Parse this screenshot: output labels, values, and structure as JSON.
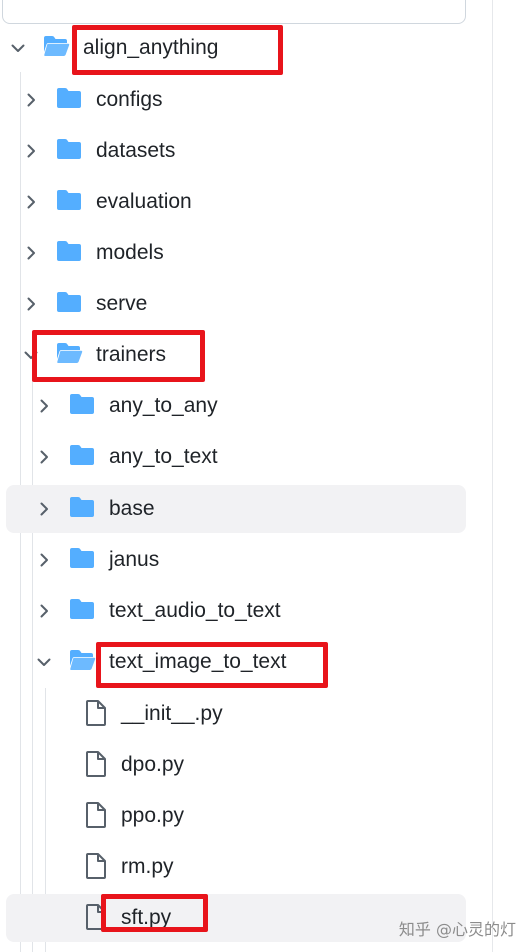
{
  "tree": {
    "root": {
      "label": "align_anything",
      "icon": "folder-open-icon"
    },
    "children": [
      {
        "label": "configs",
        "icon": "folder-icon"
      },
      {
        "label": "datasets",
        "icon": "folder-icon"
      },
      {
        "label": "evaluation",
        "icon": "folder-icon"
      },
      {
        "label": "models",
        "icon": "folder-icon"
      },
      {
        "label": "serve",
        "icon": "folder-icon"
      }
    ],
    "trainers": {
      "label": "trainers",
      "icon": "folder-open-icon"
    },
    "trainers_children": [
      {
        "label": "any_to_any",
        "icon": "folder-icon"
      },
      {
        "label": "any_to_text",
        "icon": "folder-icon"
      },
      {
        "label": "base",
        "icon": "folder-icon"
      },
      {
        "label": "janus",
        "icon": "folder-icon"
      },
      {
        "label": "text_audio_to_text",
        "icon": "folder-icon"
      }
    ],
    "tit": {
      "label": "text_image_to_text",
      "icon": "folder-open-icon"
    },
    "files": [
      {
        "label": "__init__.py",
        "icon": "file-icon"
      },
      {
        "label": "dpo.py",
        "icon": "file-icon"
      },
      {
        "label": "ppo.py",
        "icon": "file-icon"
      },
      {
        "label": "rm.py",
        "icon": "file-icon"
      },
      {
        "label": "sft.py",
        "icon": "file-icon"
      }
    ]
  },
  "watermark": "知乎 @心灵的灯",
  "colors": {
    "folder": "#54aeff",
    "highlight": "#e8141b",
    "hover": "#f2f2f4"
  }
}
